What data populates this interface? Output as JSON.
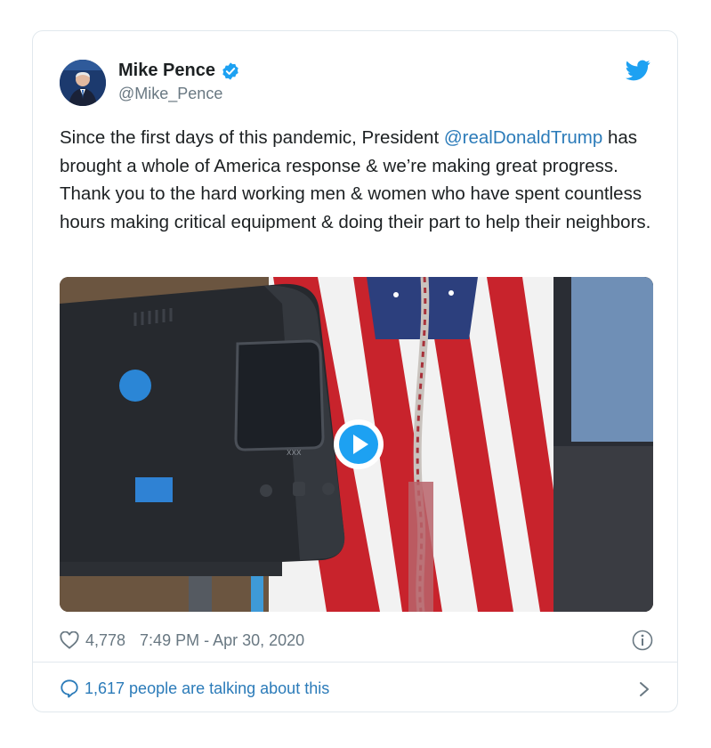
{
  "tweet": {
    "author_name": "Mike Pence",
    "author_handle": "@Mike_Pence",
    "text_before": "Since the first days of this pandemic, President ",
    "mention": "@realDonaldTrump",
    "text_after": " has brought a whole of America response & we’re making great progress. Thank you to the hard working men & women who have spent countless hours making critical equipment & doing their part to help their neighbors.",
    "likes": "4,778",
    "timestamp": "7:49 PM - Apr 30, 2020",
    "talking": "1,617 people are talking about this"
  },
  "icons": {
    "verified": "verified-badge-icon",
    "bird": "twitter-bird-icon",
    "play": "play-icon",
    "heart": "heart-icon",
    "info": "info-icon",
    "bubble": "speech-bubble-icon",
    "chevron": "chevron-right-icon"
  },
  "colors": {
    "link": "#2b7bb9",
    "twitter_blue": "#1da1f2",
    "muted": "#697882",
    "border": "#e1e8ed"
  }
}
